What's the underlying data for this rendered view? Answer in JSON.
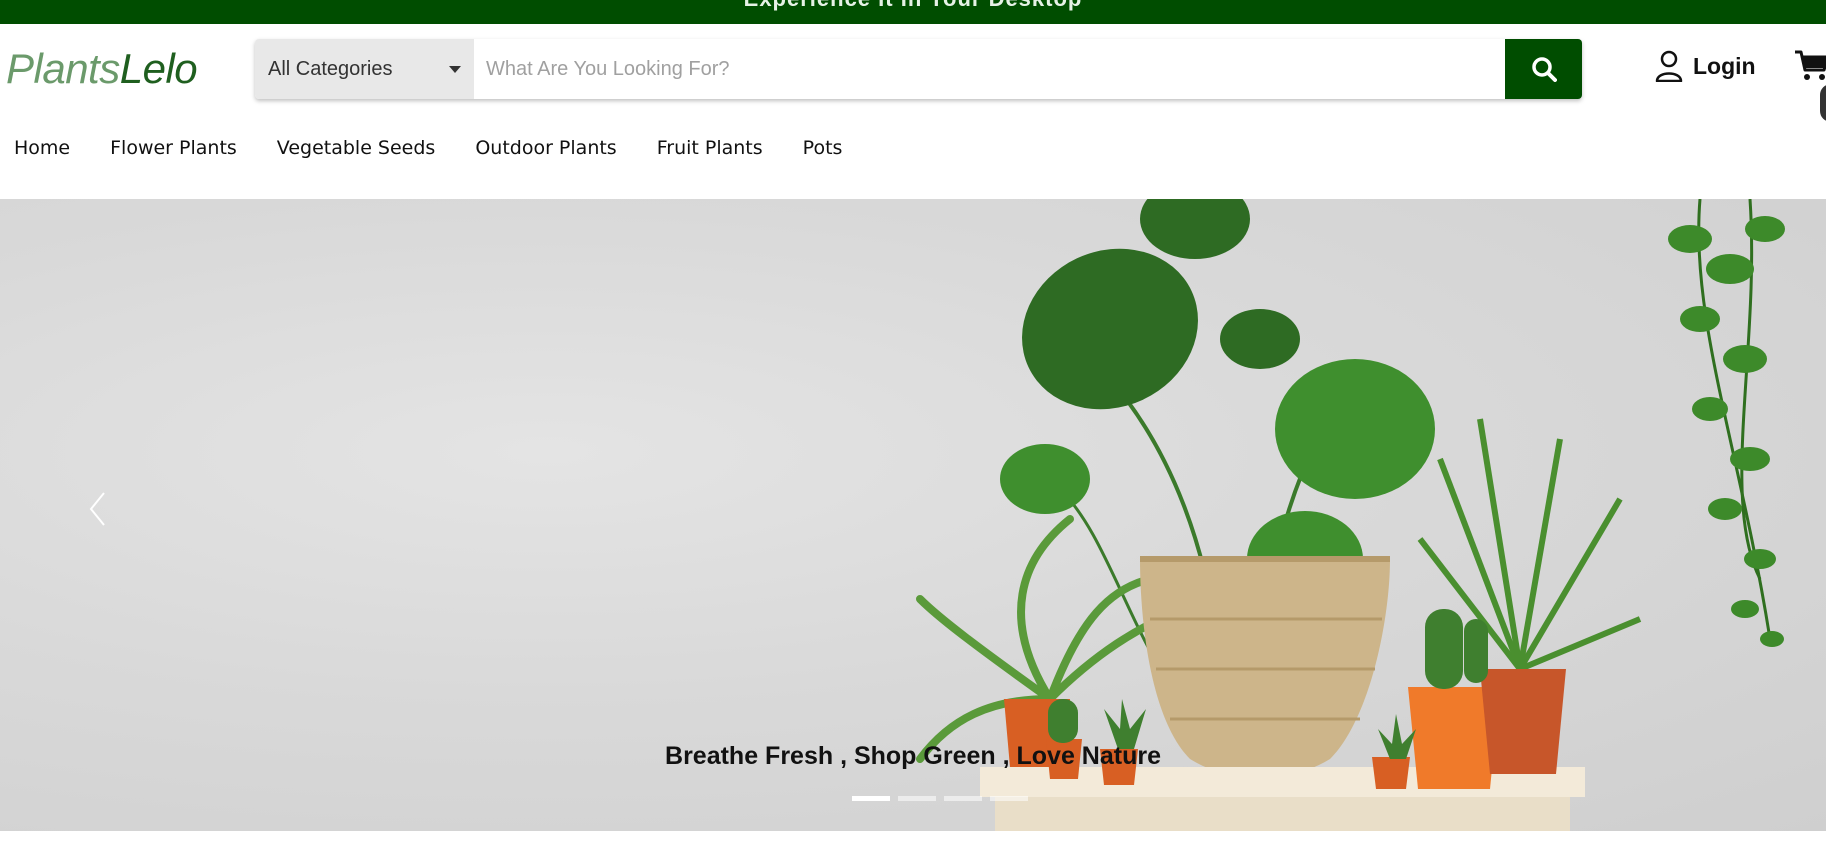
{
  "banner": {
    "text": "Experience It In Your Desktop"
  },
  "header": {
    "logo_part1": "Plants",
    "logo_part2": "Lelo",
    "category_select": "All Categories",
    "search_placeholder": "What Are You Looking For?",
    "login_label": "Login"
  },
  "nav": {
    "items": [
      "Home",
      "Flower Plants",
      "Vegetable Seeds",
      "Outdoor Plants",
      "Fruit Plants",
      "Pots"
    ]
  },
  "hero": {
    "caption": "Breathe Fresh , Shop Green , Love Nature",
    "slide_count": 4,
    "active_slide": 1
  },
  "colors": {
    "brand_green": "#004d00",
    "logo_light": "#6b9a6b",
    "logo_dark": "#1f5f1f"
  },
  "icons": [
    "search-icon",
    "user-icon",
    "cart-icon",
    "chevron-left-icon",
    "dropdown-caret-icon"
  ]
}
